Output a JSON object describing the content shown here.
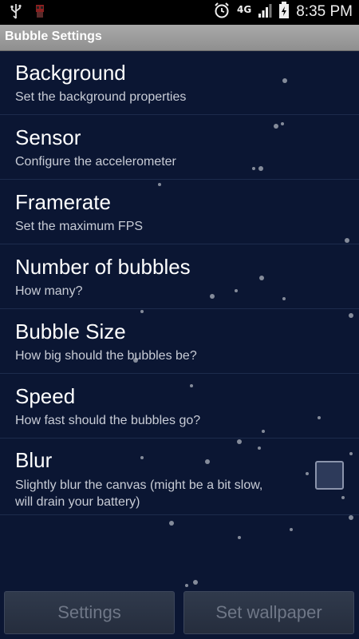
{
  "status_bar": {
    "network": "4G",
    "time": "8:35 PM",
    "icons": [
      "usb-icon",
      "app-notification-icon",
      "alarm-icon",
      "signal-icon",
      "battery-icon"
    ]
  },
  "title_bar": {
    "title": "Bubble Settings"
  },
  "settings": [
    {
      "title": "Background",
      "summary": "Set the background properties"
    },
    {
      "title": "Sensor",
      "summary": "Configure the accelerometer"
    },
    {
      "title": "Framerate",
      "summary": "Set the maximum FPS"
    },
    {
      "title": "Number of bubbles",
      "summary": "How many?"
    },
    {
      "title": "Bubble Size",
      "summary": "How big should the bubbles be?"
    },
    {
      "title": "Speed",
      "summary": "How fast should the bubbles go?"
    }
  ],
  "blur": {
    "title": "Blur",
    "summary_line1": "Slightly blur the canvas (might be a bit slow,",
    "summary_line2": "will drain your battery)",
    "checked": false
  },
  "buttons": {
    "settings": "Settings",
    "set_wallpaper": "Set wallpaper"
  },
  "colors": {
    "background": "#0b1633",
    "title_bar": "#9a9a9a",
    "text_primary": "#ffffff",
    "text_secondary": "#c8ccd6"
  }
}
